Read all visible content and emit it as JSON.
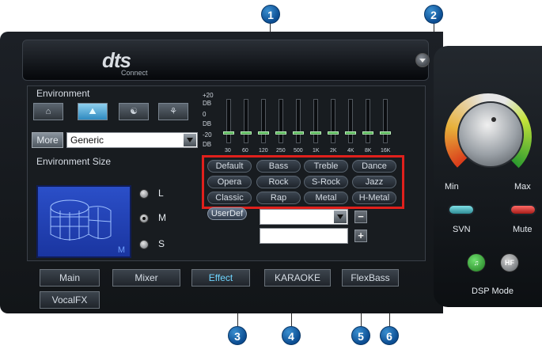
{
  "brand": {
    "logo": "dts",
    "logo_sub": "Connect"
  },
  "environment": {
    "title": "Environment",
    "more_label": "More",
    "preset_select": "Generic",
    "size_title": "Environment Size",
    "size_box_letter": "M",
    "sizes": [
      "L",
      "M",
      "S"
    ],
    "selected_size": "M"
  },
  "eq": {
    "db_labels": [
      "+20",
      "DB",
      "0",
      "DB",
      "-20",
      "DB"
    ],
    "frequencies": [
      "30",
      "60",
      "120",
      "250",
      "500",
      "1K",
      "2K",
      "4K",
      "8K",
      "16K"
    ],
    "presets": [
      [
        "Default",
        "Bass",
        "Treble",
        "Dance"
      ],
      [
        "Opera",
        "Rock",
        "S-Rock",
        "Jazz"
      ],
      [
        "Classic",
        "Rap",
        "Metal",
        "H-Metal"
      ]
    ],
    "userdef_label": "UserDef",
    "minus_label": "−",
    "plus_label": "+"
  },
  "tabs": [
    "Main",
    "Mixer",
    "Effect",
    "KARAOKE",
    "FlexBass",
    "VocalFX"
  ],
  "active_tab": "Effect",
  "right_panel": {
    "min_label": "Min",
    "max_label": "Max",
    "svn_label": "SVN",
    "mute_label": "Mute",
    "dsp_label": "DSP Mode",
    "hf_label": "HF"
  },
  "callouts": [
    "1",
    "2",
    "3",
    "4",
    "5",
    "6"
  ],
  "colors": {
    "highlight": "#e0201c",
    "callout": "#0c4d92",
    "active_tab_text": "#6fd5ff"
  }
}
